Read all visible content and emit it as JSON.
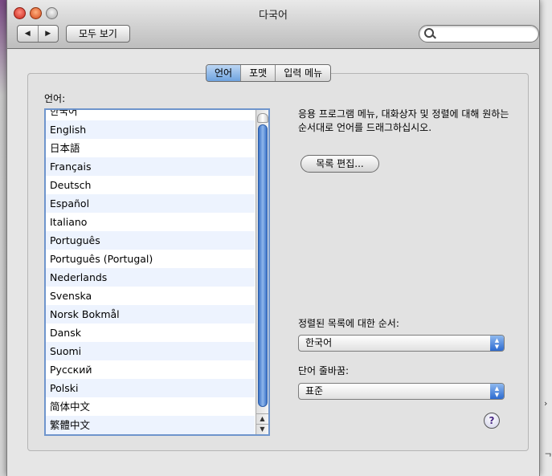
{
  "window": {
    "title": "다국어"
  },
  "toolbar": {
    "back_label": "◀",
    "forward_label": "▶",
    "show_all_label": "모두 보기",
    "search_placeholder": ""
  },
  "tabs": [
    {
      "label": "언어",
      "selected": true
    },
    {
      "label": "포맷",
      "selected": false
    },
    {
      "label": "입력 메뉴",
      "selected": false
    }
  ],
  "language_list": {
    "label": "언어:",
    "items": [
      "한국어",
      "English",
      "日本語",
      "Français",
      "Deutsch",
      "Español",
      "Italiano",
      "Português",
      "Português (Portugal)",
      "Nederlands",
      "Svenska",
      "Norsk Bokmål",
      "Dansk",
      "Suomi",
      "Русский",
      "Polski",
      "简体中文",
      "繁體中文"
    ]
  },
  "description": "응용 프로그램 메뉴, 대화상자 및 정렬에 대해 원하는 순서대로 언어를 드래그하십시오.",
  "edit_list_button": "목록 편집...",
  "sort_order": {
    "label": "정렬된 목록에 대한 순서:",
    "value": "한국어"
  },
  "word_break": {
    "label": "단어 줄바꿈:",
    "value": "표준"
  },
  "help_label": "?",
  "colors": {
    "selected_tab": "#6ea3df",
    "list_stripe": "#edf3fe",
    "scroll_thumb": "#3b73c8"
  }
}
